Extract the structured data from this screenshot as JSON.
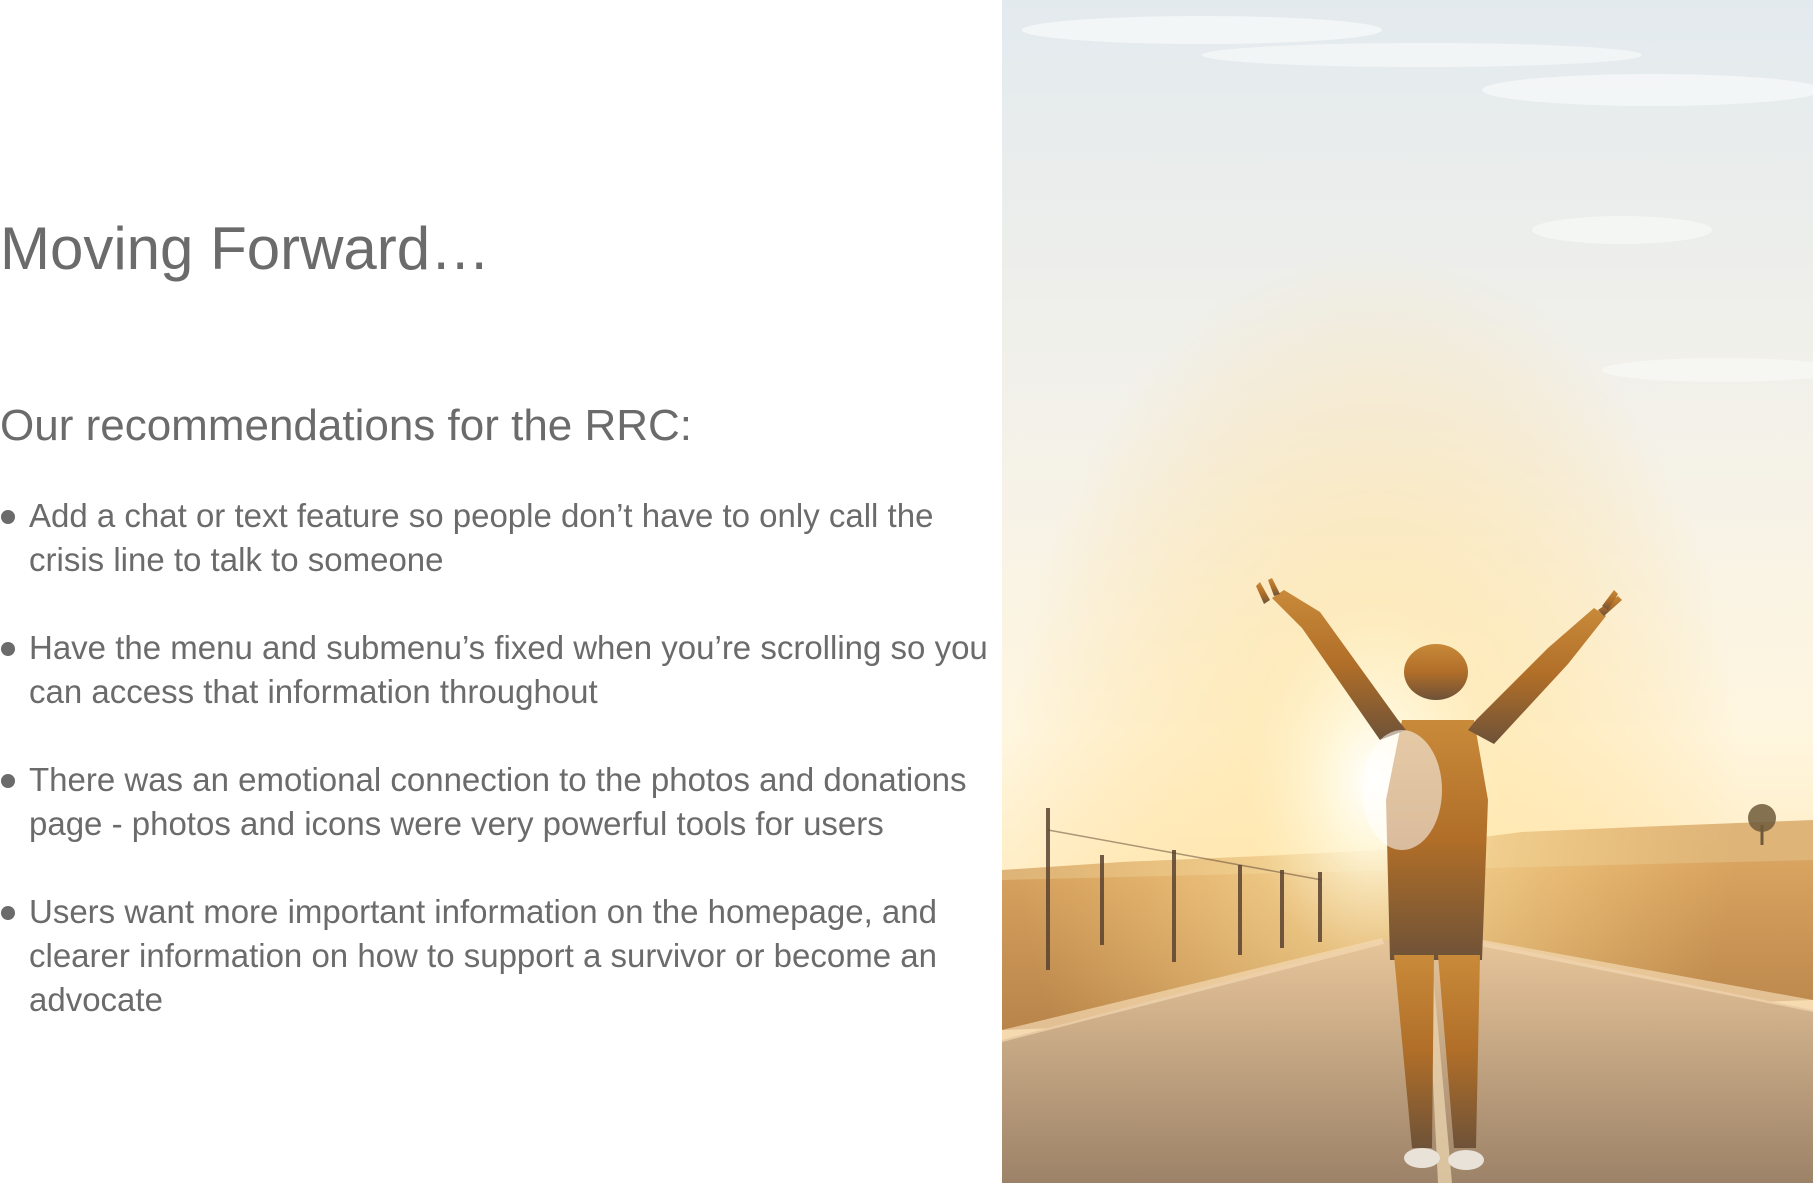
{
  "slide": {
    "title": "Moving Forward…",
    "subtitle": "Our recommendations for the RRC:",
    "bullets": [
      "Add a chat or text feature so people don’t have to only call the crisis line to talk to someone",
      "Have the menu and submenu’s fixed when you’re scrolling so you can access that information throughout",
      "There was an emotional connection to the photos and donations page - photos and icons were very powerful tools for users",
      "Users want more important information on the homepage, and clearer information on how to support a survivor or become an advocate"
    ]
  },
  "colors": {
    "text": "#6b6b6b",
    "sun_glow": "#ffd27a",
    "sky": "#e8eef2",
    "road": "#a08a70"
  }
}
